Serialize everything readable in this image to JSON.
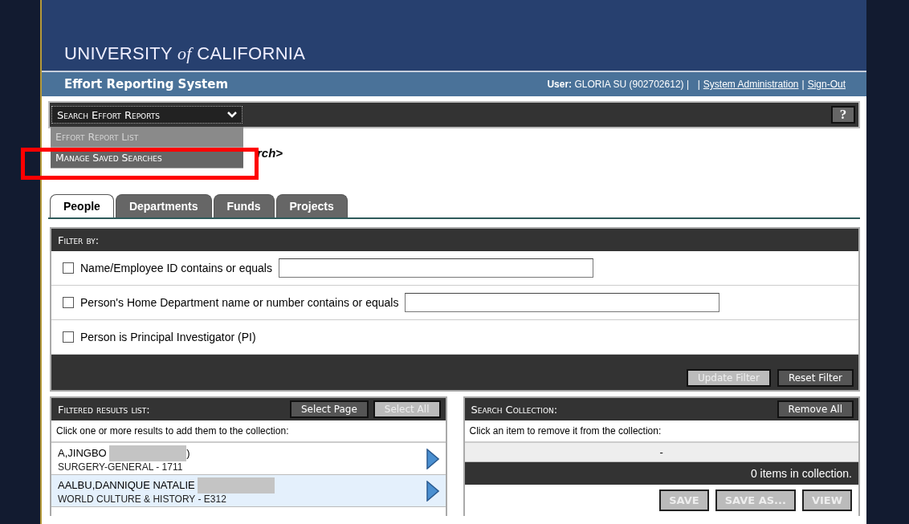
{
  "header": {
    "org_before": "UNIVERSITY",
    "org_italic": "of",
    "org_after": "CALIFORNIA",
    "app_title": "Effort Reporting System",
    "user_label": "User:",
    "user_value": "GLORIA SU (902702612) |",
    "sep": "|",
    "links": [
      "System Administration",
      "Sign-Out"
    ],
    "link_sep": "|"
  },
  "nav": {
    "dropdown": "Search Effort Reports",
    "help": "?",
    "menu": [
      {
        "label": "Effort Report List",
        "selected": false
      },
      {
        "label": "Manage Saved Searches",
        "selected": true
      }
    ],
    "heading_fragment": "rch>"
  },
  "tabs": [
    {
      "label": "People",
      "selected": true
    },
    {
      "label": "Departments",
      "selected": false
    },
    {
      "label": "Funds",
      "selected": false
    },
    {
      "label": "Projects",
      "selected": false
    }
  ],
  "filter": {
    "title": "Filter by:",
    "rows": [
      {
        "label": "Name/Employee ID contains or equals",
        "checked": false,
        "kind": "field"
      },
      {
        "label": "Person's Home Department name or number contains or equals",
        "checked": false,
        "kind": "field"
      },
      {
        "label": "Person is Principal Investigator (PI)",
        "checked": false,
        "kind": "check"
      }
    ],
    "buttons": [
      {
        "label": "Update Filter",
        "disabled": true
      },
      {
        "label": "Reset Filter",
        "disabled": false
      }
    ]
  },
  "results": {
    "title": "Filtered results list:",
    "buttons": [
      {
        "label": "Select Page",
        "disabled": false
      },
      {
        "label": "Select All",
        "disabled": true
      }
    ],
    "hint": "Click one or more results to add them to the collection:",
    "items": [
      {
        "name": "A,JINGBO",
        "name_end": ")",
        "dept": "SURGERY-GENERAL - 1711",
        "selected": false
      },
      {
        "name": "AALBU,DANNIQUE NATALIE",
        "dept": "WORLD CULTURE & HISTORY - E312",
        "selected": true
      }
    ]
  },
  "collection": {
    "title": "Search Collection:",
    "remove_all": "Remove All",
    "hint": "Click an item to remove it from the collection:",
    "empty": "-",
    "count": "0 items in collection.",
    "buttons": [
      {
        "label": "SAVE",
        "disabled": true
      },
      {
        "label": "SAVE AS...",
        "disabled": true
      },
      {
        "label": "VIEW",
        "disabled": true
      }
    ]
  }
}
